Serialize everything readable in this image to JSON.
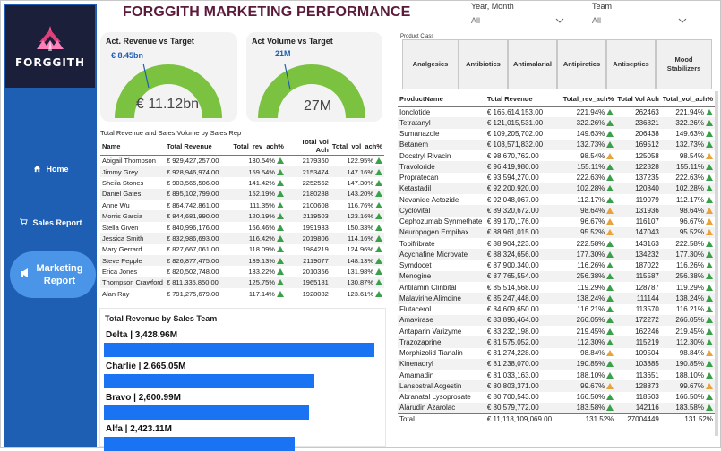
{
  "header": {
    "title": "FORGGITH MARKETING PERFORMANCE",
    "slicer_year": {
      "label": "Year, Month",
      "value": "All"
    },
    "slicer_team": {
      "label": "Team",
      "value": "All"
    }
  },
  "sidebar": {
    "logo_text": "FORGGITH",
    "items": [
      {
        "label": "Home",
        "icon": "home-icon"
      },
      {
        "label": "Sales Report",
        "icon": "cart-icon"
      },
      {
        "label": "Marketing Report",
        "icon": "megaphone-icon",
        "active": true
      }
    ]
  },
  "gauges": [
    {
      "title": "Act. Revenue vs Target",
      "target": "€ 8.45bn",
      "value": "€ 11.12bn",
      "fill_fraction": 1.0
    },
    {
      "title": "Act Volume vs Target",
      "target": "21M",
      "value": "27M",
      "fill_fraction": 1.0
    }
  ],
  "sales_rep_table": {
    "caption": "Total Revenue and Sales Volume by Sales Rep",
    "columns": [
      "Name",
      "Total Revenue",
      "Total_rev_ach%",
      "Total Vol Ach",
      "Total_vol_ach%"
    ],
    "rows": [
      [
        "Abigail Thompson",
        "€ 929,427,257.00",
        "130.54%",
        "2179360",
        "122.95%"
      ],
      [
        "Jimmy Grey",
        "€ 928,946,974.00",
        "159.54%",
        "2153474",
        "147.16%"
      ],
      [
        "Sheila Stones",
        "€ 903,565,506.00",
        "141.42%",
        "2252562",
        "147.30%"
      ],
      [
        "Daniel Gates",
        "€ 895,102,799.00",
        "152.19%",
        "2180288",
        "143.20%"
      ],
      [
        "Anne Wu",
        "€ 864,742,861.00",
        "111.35%",
        "2100608",
        "116.76%"
      ],
      [
        "Morris Garcia",
        "€ 844,681,990.00",
        "120.19%",
        "2119503",
        "123.16%"
      ],
      [
        "Stella Given",
        "€ 840,996,176.00",
        "166.46%",
        "1991933",
        "150.33%"
      ],
      [
        "Jessica Smith",
        "€ 832,986,693.00",
        "116.42%",
        "2019806",
        "114.16%"
      ],
      [
        "Mary Gerrard",
        "€ 827,667,061.00",
        "118.09%",
        "1984219",
        "124.96%"
      ],
      [
        "Steve Pepple",
        "€ 826,877,475.00",
        "139.13%",
        "2119077",
        "148.13%"
      ],
      [
        "Erica Jones",
        "€ 820,502,748.00",
        "133.22%",
        "2010356",
        "131.98%"
      ],
      [
        "Thompson Crawford",
        "€ 811,335,850.00",
        "125.75%",
        "1965181",
        "130.87%"
      ],
      [
        "Alan Ray",
        "€ 791,275,679.00",
        "117.14%",
        "1928082",
        "123.61%"
      ]
    ]
  },
  "team_chart": {
    "title": "Total Revenue by Sales Team",
    "labels": [
      "Delta | 3,428.96M",
      "Charlie | 2,665.05M",
      "Bravo | 2,600.99M",
      "Alfa | 2,423.11M"
    ]
  },
  "chart_data": {
    "type": "bar",
    "title": "Total Revenue by Sales Team",
    "categories": [
      "Delta",
      "Charlie",
      "Bravo",
      "Alfa"
    ],
    "values": [
      3428.96,
      2665.05,
      2600.99,
      2423.11
    ],
    "bar_color": "#1a73f2"
  },
  "product_class": {
    "caption": "Product Class",
    "buttons": [
      "Analgesics",
      "Antibiotics",
      "Antimalarial",
      "Antipiretics",
      "Antiseptics",
      "Mood Stabilizers"
    ]
  },
  "product_table": {
    "columns": [
      "ProductName",
      "Total Revenue",
      "Total_rev_ach%",
      "Total Vol Ach",
      "Total_vol_ach%"
    ],
    "rows": [
      [
        "Ionclotide",
        "€ 165,614,153.00",
        "221.94%",
        "262463",
        "221.94%",
        "up"
      ],
      [
        "Tetratanyl",
        "€ 121,015,531.00",
        "322.26%",
        "236821",
        "322.26%",
        "up"
      ],
      [
        "Sumanazole",
        "€ 109,205,702.00",
        "149.63%",
        "206438",
        "149.63%",
        "up"
      ],
      [
        "Betanem",
        "€ 103,571,832.00",
        "132.73%",
        "169512",
        "132.73%",
        "up"
      ],
      [
        "Docstryl Rivacin",
        "€ 98,670,762.00",
        "98.54%",
        "125058",
        "98.54%",
        "warn"
      ],
      [
        "Travoloride",
        "€ 96,419,980.00",
        "155.11%",
        "122828",
        "155.11%",
        "up"
      ],
      [
        "Propratecan",
        "€ 93,594,270.00",
        "222.63%",
        "137235",
        "222.63%",
        "up"
      ],
      [
        "Ketastadil",
        "€ 92,200,920.00",
        "102.28%",
        "120840",
        "102.28%",
        "up"
      ],
      [
        "Nevanide Actozide",
        "€ 92,048,067.00",
        "112.17%",
        "119079",
        "112.17%",
        "up"
      ],
      [
        "Cyclovital",
        "€ 89,320,672.00",
        "98.64%",
        "131936",
        "98.64%",
        "warn"
      ],
      [
        "Cephozumab Synmethate",
        "€ 89,170,176.00",
        "96.67%",
        "116107",
        "96.67%",
        "warn"
      ],
      [
        "Neuropogen Empibax",
        "€ 88,961,015.00",
        "95.52%",
        "147043",
        "95.52%",
        "warn"
      ],
      [
        "Topifribrate",
        "€ 88,904,223.00",
        "222.58%",
        "143163",
        "222.58%",
        "up"
      ],
      [
        "Acycnafine Microvate",
        "€ 88,324,656.00",
        "177.30%",
        "134232",
        "177.30%",
        "up"
      ],
      [
        "Symdocet",
        "€ 87,900,340.00",
        "116.26%",
        "187022",
        "116.26%",
        "up"
      ],
      [
        "Menogine",
        "€ 87,765,554.00",
        "256.38%",
        "115587",
        "256.38%",
        "up"
      ],
      [
        "Antilamin Clinbital",
        "€ 85,514,568.00",
        "119.29%",
        "128787",
        "119.29%",
        "up"
      ],
      [
        "Malavirine Alimdine",
        "€ 85,247,448.00",
        "138.24%",
        "111144",
        "138.24%",
        "up"
      ],
      [
        "Flutacerol",
        "€ 84,609,650.00",
        "116.21%",
        "113570",
        "116.21%",
        "up"
      ],
      [
        "Amavirase",
        "€ 83,896,464.00",
        "266.05%",
        "172272",
        "266.05%",
        "up"
      ],
      [
        "Antaparin Varizyme",
        "€ 83,232,198.00",
        "219.45%",
        "162246",
        "219.45%",
        "up"
      ],
      [
        "Trazozaprine",
        "€ 81,575,052.00",
        "112.30%",
        "115219",
        "112.30%",
        "up"
      ],
      [
        "Morphizolid Tianalin",
        "€ 81,274,228.00",
        "98.84%",
        "109504",
        "98.84%",
        "warn"
      ],
      [
        "Kinenadryl",
        "€ 81,238,070.00",
        "190.85%",
        "103885",
        "190.85%",
        "up"
      ],
      [
        "Amamadin",
        "€ 81,033,163.00",
        "188.10%",
        "113651",
        "188.10%",
        "up"
      ],
      [
        "Lansostral Acgestin",
        "€ 80,803,371.00",
        "99.67%",
        "128873",
        "99.67%",
        "warn"
      ],
      [
        "Abranatal Lysoprosate",
        "€ 80,700,543.00",
        "166.50%",
        "118503",
        "166.50%",
        "up"
      ],
      [
        "Alarudin Azarolac",
        "€ 80,579,772.00",
        "183.58%",
        "142116",
        "183.58%",
        "up"
      ]
    ],
    "total": [
      "Total",
      "€ 11,118,109,069.00",
      "131.52%",
      "27004449",
      "131.52%"
    ]
  },
  "colors": {
    "sidebar": "#1f5fb3",
    "active_nav": "#4a95e8",
    "gauge_fill": "#7cc241",
    "title": "#5a1a3a",
    "bar": "#1a73f2",
    "up_indicator": "#3aa04a",
    "warn_indicator": "#e8a33a"
  }
}
